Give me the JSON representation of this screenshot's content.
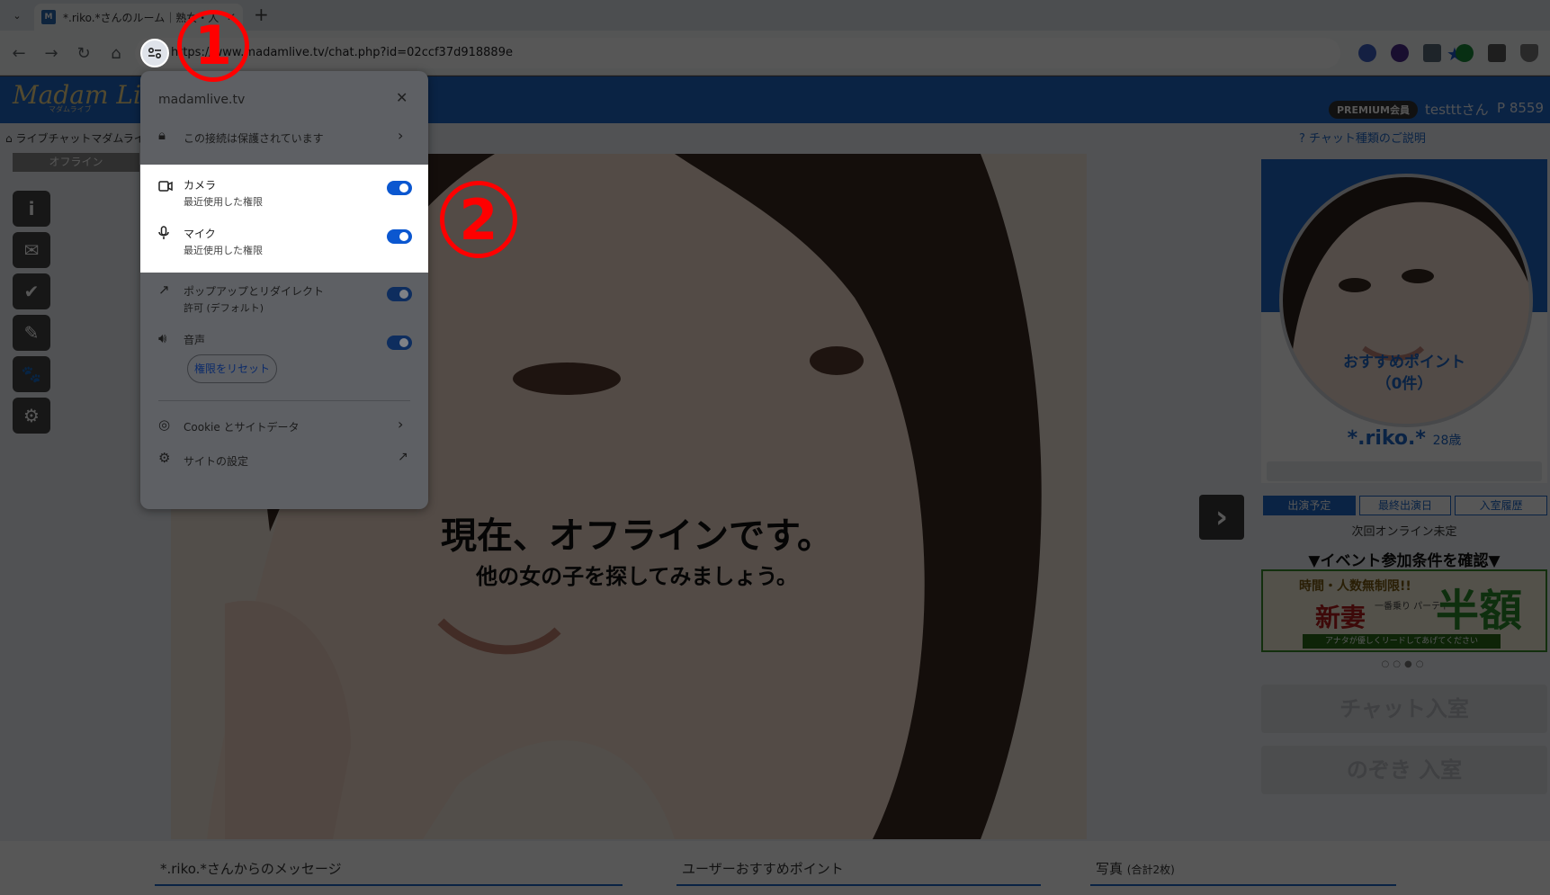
{
  "browser": {
    "tab_title": "*.riko.*さんのルーム｜熟女・人",
    "tab_close": "✕",
    "tab_menu": "⌄",
    "new_tab": "+",
    "favicon": "M",
    "url": "https://www.madamlive.tv/chat.php?id=02ccf37d918889e",
    "star": "★",
    "nav": {
      "back": "←",
      "forward": "→",
      "reload": "↻",
      "home": "⌂"
    },
    "extension_colors": [
      "#3b5fc0",
      "#4a2a8a",
      "#5a6a7a",
      "#1a8a3a",
      "#5a5a5a",
      "#7a7a7a"
    ]
  },
  "site": {
    "logo": "Madam Live",
    "logo_sub": "マダムライブ",
    "membership_badge": "PREMIUM会員",
    "username": "testttさん",
    "points": "P 8559",
    "breadcrumb": "ライブチャットマダムライブ",
    "chat_explain": "チャット種類のご説明",
    "offline_label": "オフライン",
    "side_icons": [
      "i",
      "✉",
      "✔",
      "✎",
      "🐾",
      "⚙"
    ],
    "offline_main": "現在、オフラインです。",
    "offline_sub": "他の女の子を探してみましょう。",
    "next_arrow": "›"
  },
  "profile": {
    "recommend_title": "おすすめポイント",
    "recommend_count": "（0件）",
    "name": "*.riko.*",
    "age": "28歳",
    "schedule_tabs": [
      "出演予定",
      "最終出演日",
      "入室履歴"
    ],
    "next_online": "次回オンライン未定",
    "event_condition": "▼イベント参加条件を確認▼",
    "banner": {
      "top_text": "時間・人数無制限!!",
      "main": "新妻",
      "party": "一番乗り パーティ",
      "half": "半額",
      "bottom": "アナタが優しくリードしてあげてください"
    },
    "dots": "○○●○",
    "chat_enter": "チャット入室",
    "peek_enter": "のぞき 入室"
  },
  "bottom": {
    "messages_title": "*.riko.*さんからのメッセージ",
    "user_recommend_title": "ユーザーおすすめポイント",
    "photos_title": "写真",
    "photos_count": "(合計2枚)"
  },
  "popup": {
    "domain": "madamlive.tv",
    "close": "✕",
    "connection": "この接続は保護されています",
    "camera": {
      "label": "カメラ",
      "sub": "最近使用した権限",
      "on": true
    },
    "mic": {
      "label": "マイク",
      "sub": "最近使用した権限",
      "on": true
    },
    "popups": {
      "label": "ポップアップとリダイレクト",
      "sub": "許可 (デフォルト)",
      "on": true
    },
    "sound": {
      "label": "音声",
      "on": true
    },
    "reset": "権限をリセット",
    "cookies": "Cookie とサイトデータ",
    "site_settings": "サイトの設定"
  },
  "annotations": {
    "step1": "1",
    "step2": "2",
    "color": "#ff0000"
  }
}
